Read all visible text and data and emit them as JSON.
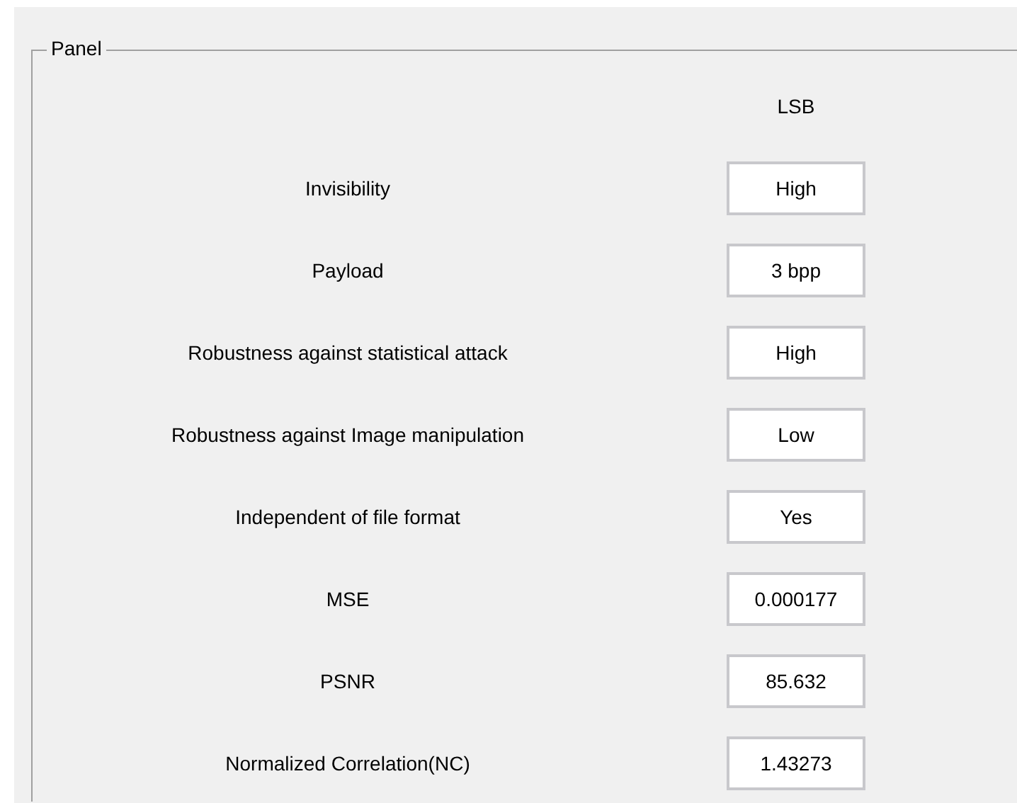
{
  "panel": {
    "title": "Panel",
    "column_header": "LSB",
    "rows": [
      {
        "label": "Invisibility",
        "value": "High"
      },
      {
        "label": "Payload",
        "value": "3 bpp"
      },
      {
        "label": "Robustness against statistical attack",
        "value": "High"
      },
      {
        "label": "Robustness against Image manipulation",
        "value": "Low"
      },
      {
        "label": "Independent of file format",
        "value": "Yes"
      },
      {
        "label": "MSE",
        "value": "0.000177"
      },
      {
        "label": "PSNR",
        "value": "85.632"
      },
      {
        "label": "Normalized Correlation(NC)",
        "value": "1.43273"
      }
    ]
  }
}
